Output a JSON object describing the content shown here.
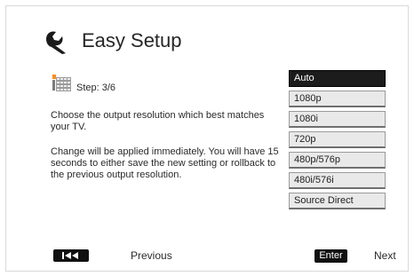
{
  "header": {
    "title": "Easy Setup",
    "icon": "wrench-icon"
  },
  "step": {
    "label": "Step: 3/6",
    "icon": "step-grid-icon"
  },
  "instructions": {
    "line1": "Choose the output resolution which best matches your TV.",
    "line2": "Change will be applied immediately.  You will have 15 seconds to either save the new setting or rollback to the previous output resolution."
  },
  "resolutions": {
    "selected": "Auto",
    "options": [
      {
        "label": "Auto"
      },
      {
        "label": "1080p"
      },
      {
        "label": "1080i"
      },
      {
        "label": "720p"
      },
      {
        "label": "480p/576p"
      },
      {
        "label": "480i/576i"
      },
      {
        "label": "Source Direct"
      }
    ]
  },
  "footer": {
    "previous_key_icon": "skip-previous-icon",
    "previous_label": "Previous",
    "enter_label": "Enter",
    "next_label": "Next"
  },
  "colors": {
    "selected_background": "#1c1c1c",
    "option_background": "#e9e9e9"
  }
}
